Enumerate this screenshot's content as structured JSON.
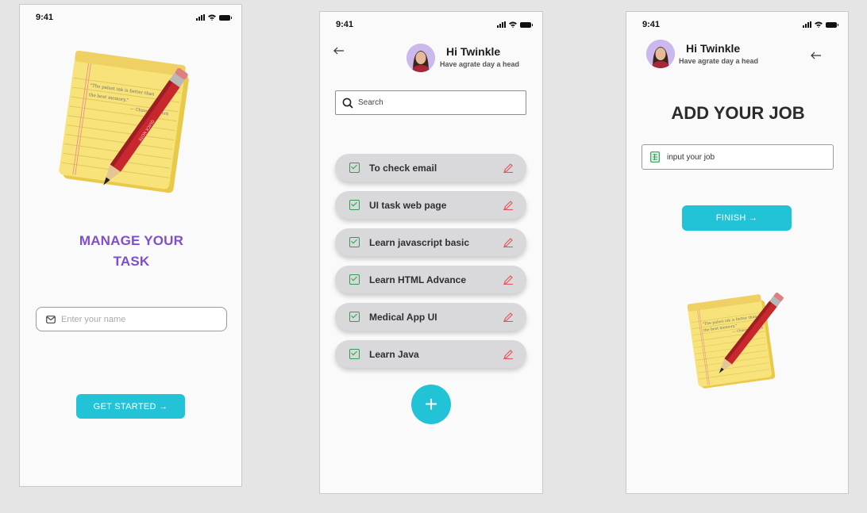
{
  "screens": {
    "welcome": {
      "status_time": "9:41",
      "title_line1": "MANAGE YOUR",
      "title_line2": "TASK",
      "name_placeholder": "Enter your name",
      "start_button": "GET STARTED →",
      "note_text_1": "\"The palest ink is better than",
      "note_text_2": "the best memory.\"",
      "note_author": "— Chinese Proverb"
    },
    "task_list": {
      "status_time": "9:41",
      "greeting": "Hi Twinkle",
      "subgreeting": "Have agrate day a head",
      "search_placeholder": "Search",
      "tasks": [
        {
          "label": "To check email"
        },
        {
          "label": "UI task web page"
        },
        {
          "label": "Learn javascript basic"
        },
        {
          "label": "Learn HTML Advance"
        },
        {
          "label": "Medical App UI"
        },
        {
          "label": "Learn Java"
        }
      ],
      "add_button": "+"
    },
    "add_job": {
      "status_time": "9:41",
      "greeting": "Hi Twinkle",
      "subgreeting": "Have agrate day a head",
      "title": "ADD YOUR JOB",
      "job_placeholder": "input your job",
      "finish_button": "FINISH →"
    }
  },
  "colors": {
    "accent_teal": "#22c3d6",
    "title_purple": "#7b4fd1",
    "check_green": "#2e9e54",
    "edit_red": "#e0585f"
  },
  "icons": {
    "mail": "mail-icon",
    "search": "search-icon",
    "checkbox": "checkbox-icon",
    "edit": "pencil-icon",
    "sheet": "spreadsheet-icon",
    "back": "back-arrow-icon"
  }
}
